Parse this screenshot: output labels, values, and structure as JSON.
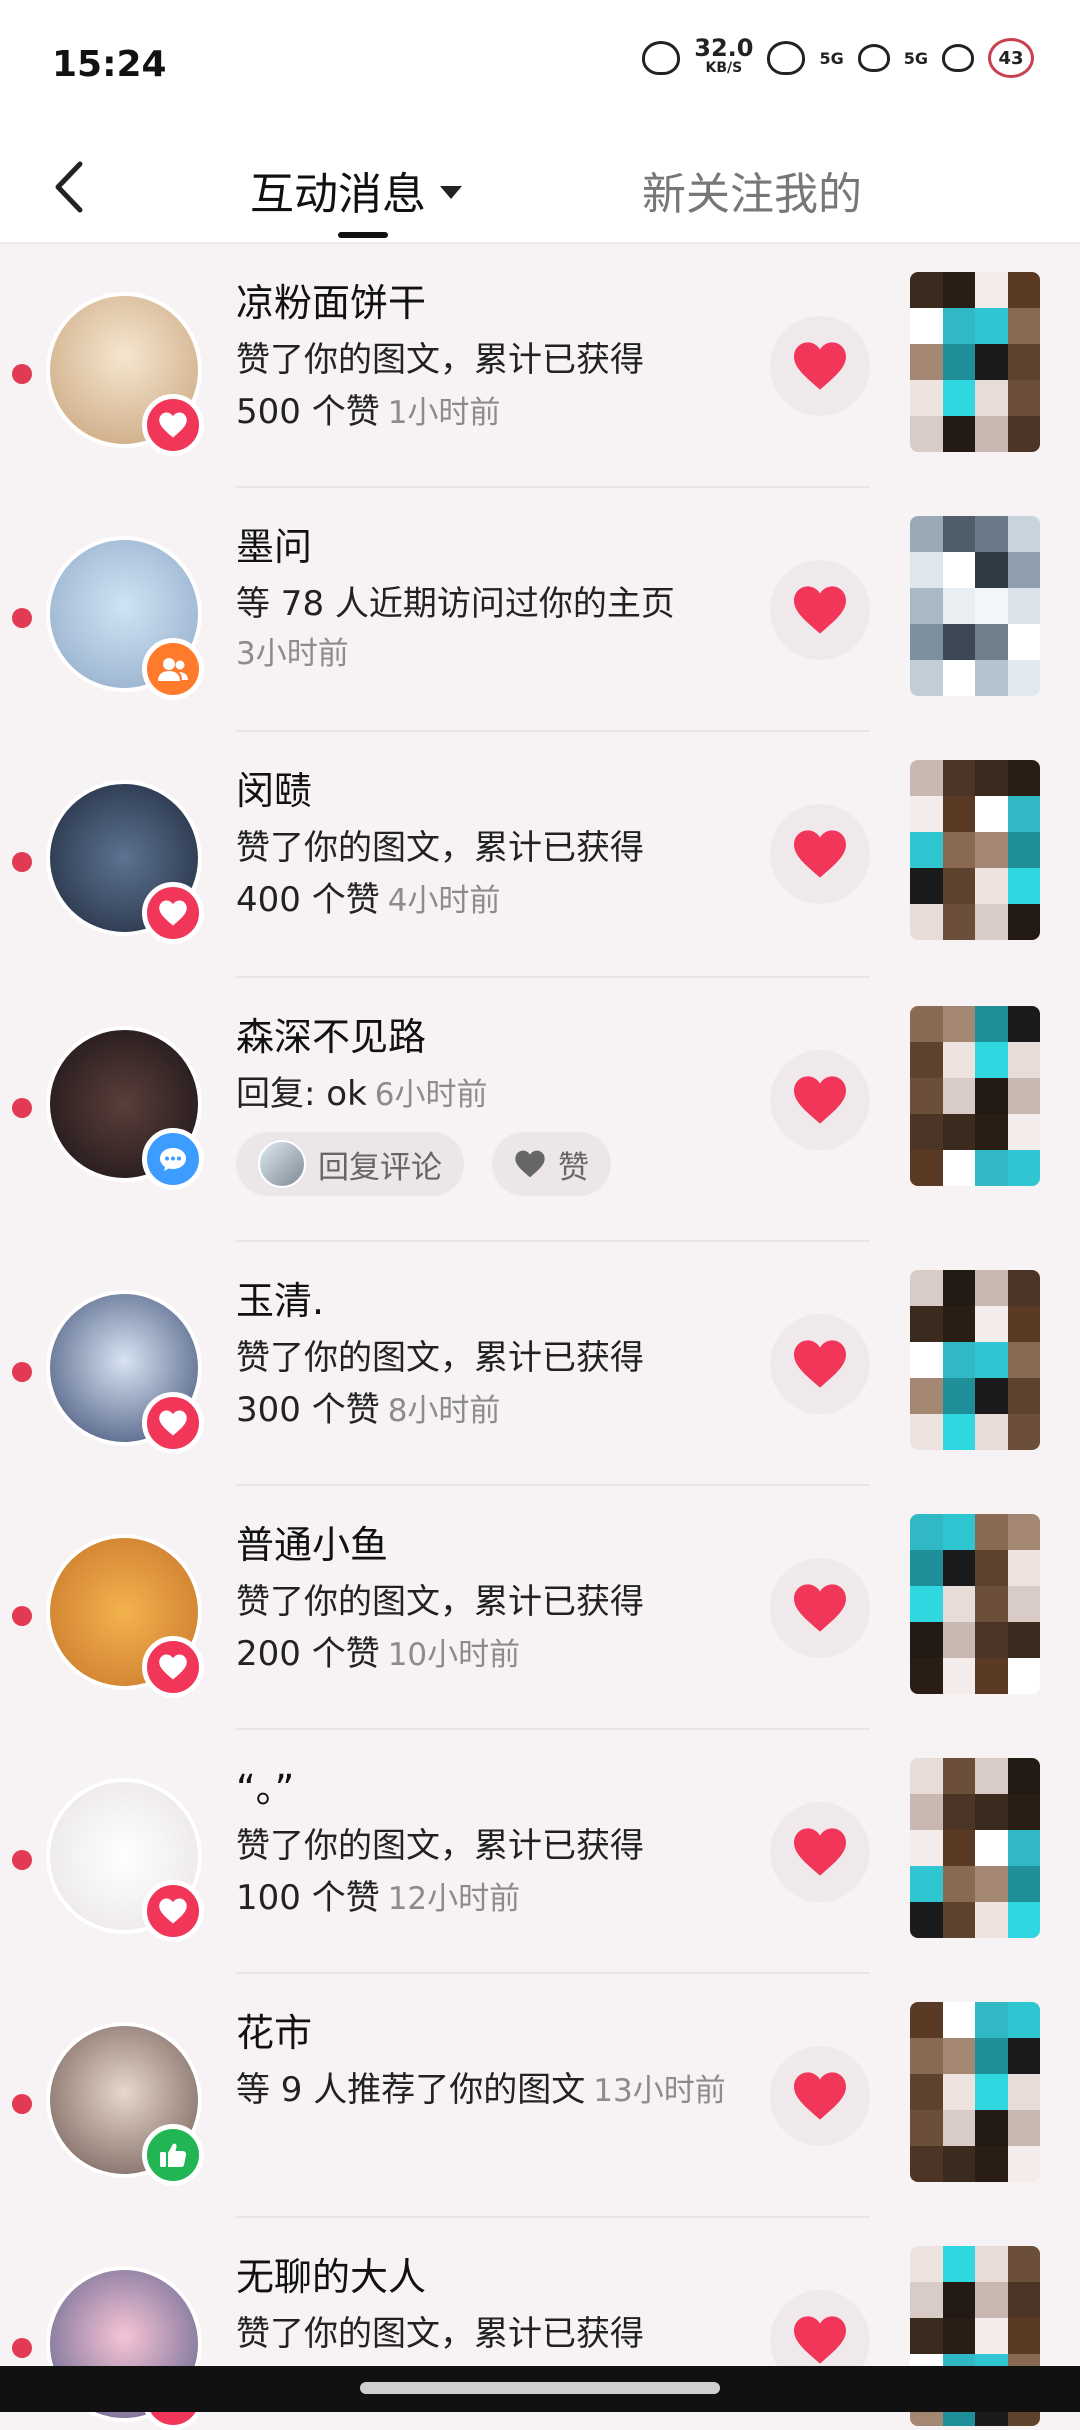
{
  "status_bar": {
    "time": "15:24",
    "speed_value": "32.0",
    "speed_unit": "KB/S",
    "signal_1": "5G",
    "signal_2": "5G",
    "battery": "43"
  },
  "header": {
    "back_icon": "chevron-left-icon",
    "active_tab": "互动消息",
    "second_tab": "新关注我的"
  },
  "colors": {
    "accent": "#f2365a",
    "unread_dot": "#e23a52",
    "follow_badge": "#ff7a2b",
    "comment_badge": "#3d9cff",
    "thumb_badge": "#21b554"
  },
  "notifications": [
    {
      "name": "凉粉面饼干",
      "line1": "赞了你的图文，累计已获得",
      "line2": "500 个赞",
      "time": "1小时前",
      "badge": "like"
    },
    {
      "name": "墨问",
      "line1": "等 78 人近期访问过你的主页",
      "line2": "",
      "time": "3小时前",
      "badge": "follow"
    },
    {
      "name": "闵赜",
      "line1": "赞了你的图文，累计已获得",
      "line2": "400 个赞",
      "time": "4小时前",
      "badge": "like"
    },
    {
      "name": "森深不见路",
      "line1": "回复: ok",
      "line2": "",
      "time": "6小时前",
      "badge": "comment",
      "reply_button": "回复评论",
      "like_button": "赞"
    },
    {
      "name": "玉清.",
      "line1": "赞了你的图文，累计已获得",
      "line2": "300 个赞",
      "time": "8小时前",
      "badge": "like"
    },
    {
      "name": "普通小鱼",
      "line1": "赞了你的图文，累计已获得",
      "line2": "200 个赞",
      "time": "10小时前",
      "badge": "like"
    },
    {
      "name": "“。”",
      "line1": "赞了你的图文，累计已获得",
      "line2": "100 个赞",
      "time": "12小时前",
      "badge": "like"
    },
    {
      "name": "花市",
      "line1": "等 9 人推荐了你的图文",
      "line2": "",
      "time": "13小时前",
      "badge": "thumb"
    },
    {
      "name": "无聊的大人",
      "line1": "赞了你的图文，累计已获得",
      "line2": "",
      "time": "",
      "badge": "like"
    }
  ]
}
